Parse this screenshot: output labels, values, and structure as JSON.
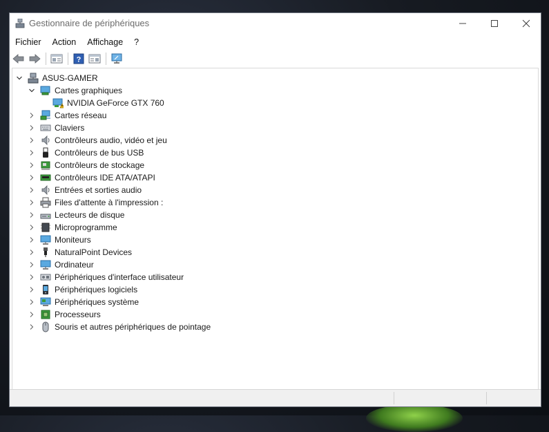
{
  "window": {
    "title": "Gestionnaire de périphériques",
    "controls": {
      "minimize": "—",
      "maximize": "☐",
      "close": "✕"
    }
  },
  "menu": [
    "Fichier",
    "Action",
    "Affichage",
    "?"
  ],
  "toolbar": [
    "back-arrow-icon",
    "forward-arrow-icon",
    "properties-icon",
    "help-icon",
    "view-icon",
    "monitor-scan-icon"
  ],
  "tree": {
    "root": {
      "label": "ASUS-GAMER",
      "icon": "computer-icon",
      "expanded": true
    },
    "categories": [
      {
        "label": "Cartes graphiques",
        "icon": "display-adapter-icon",
        "expanded": true,
        "children": [
          {
            "label": "NVIDIA GeForce GTX 760",
            "icon": "display-adapter-warning-icon"
          }
        ]
      },
      {
        "label": "Cartes réseau",
        "icon": "network-icon"
      },
      {
        "label": "Claviers",
        "icon": "keyboard-icon"
      },
      {
        "label": "Contrôleurs audio, vidéo et jeu",
        "icon": "speaker-icon"
      },
      {
        "label": "Contrôleurs de bus USB",
        "icon": "usb-icon"
      },
      {
        "label": "Contrôleurs de stockage",
        "icon": "storage-controller-icon"
      },
      {
        "label": "Contrôleurs IDE ATA/ATAPI",
        "icon": "ide-icon"
      },
      {
        "label": "Entrées et sorties audio",
        "icon": "speaker-icon"
      },
      {
        "label": "Files d'attente à l'impression :",
        "icon": "printer-icon"
      },
      {
        "label": "Lecteurs de disque",
        "icon": "disk-drive-icon"
      },
      {
        "label": "Microprogramme",
        "icon": "firmware-icon"
      },
      {
        "label": "Moniteurs",
        "icon": "monitor-icon"
      },
      {
        "label": "NaturalPoint Devices",
        "icon": "device-plug-icon"
      },
      {
        "label": "Ordinateur",
        "icon": "monitor-icon"
      },
      {
        "label": "Périphériques d'interface utilisateur",
        "icon": "hid-icon"
      },
      {
        "label": "Périphériques logiciels",
        "icon": "software-device-icon"
      },
      {
        "label": "Périphériques système",
        "icon": "system-device-icon"
      },
      {
        "label": "Processeurs",
        "icon": "processor-icon"
      },
      {
        "label": "Souris et autres périphériques de pointage",
        "icon": "mouse-icon"
      }
    ]
  },
  "colors": {
    "accent": "#2f7fc6",
    "warning": "#f2c21b",
    "window_bg": "#ffffff",
    "statusbar": "#f0f0f0"
  }
}
